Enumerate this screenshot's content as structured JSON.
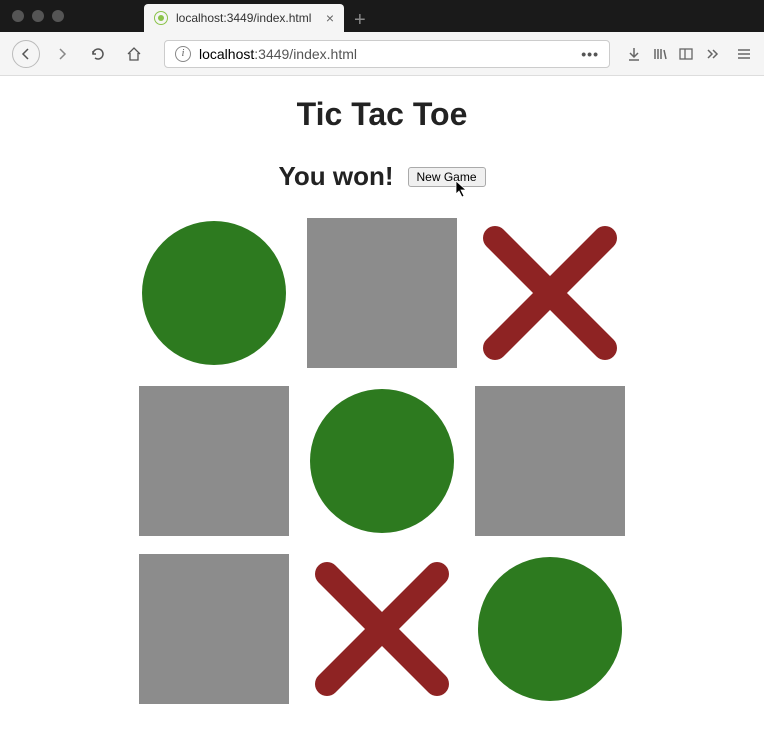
{
  "browser": {
    "tab_title": "localhost:3449/index.html",
    "url_host": "localhost",
    "url_rest": ":3449/index.html"
  },
  "game": {
    "title": "Tic Tac Toe",
    "status": "You won!",
    "new_game_label": "New Game",
    "board": [
      [
        "O",
        "",
        "X"
      ],
      [
        "",
        "O",
        ""
      ],
      [
        "",
        "X",
        "O"
      ]
    ],
    "colors": {
      "o": "#2d7a1f",
      "x": "#8e2323",
      "empty": "#8c8c8c"
    }
  }
}
